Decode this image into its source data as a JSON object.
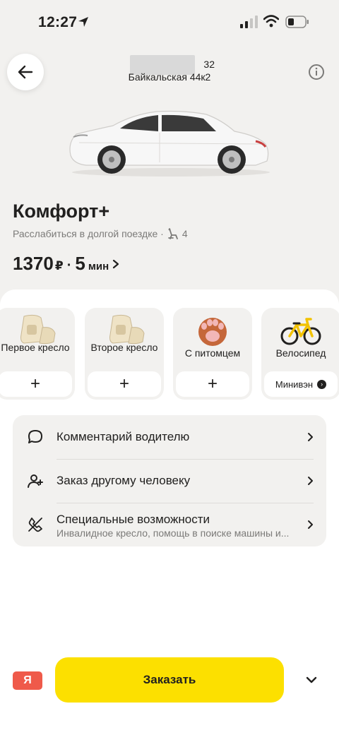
{
  "status_bar": {
    "time": "12:27"
  },
  "header": {
    "route_line1": "32",
    "route_line2": "Байкальская 44к2"
  },
  "tariff": {
    "name": "Комфорт+",
    "description": "Расслабиться в долгой поездке ·",
    "seats": "4",
    "price": "1370",
    "currency": "₽",
    "separator": "·",
    "eta": "5",
    "eta_unit": "мин"
  },
  "options": [
    {
      "label": "Первое кресло",
      "action": "+"
    },
    {
      "label": "Второе кресло",
      "action": "+"
    },
    {
      "label": "С питомцем",
      "action": "+"
    },
    {
      "label": "Велосипед",
      "action": "Минивэн"
    }
  ],
  "list": [
    {
      "title": "Комментарий водителю",
      "icon": "comment-icon"
    },
    {
      "title": "Заказ другому человеку",
      "icon": "add-person-icon"
    },
    {
      "title": "Специальные возможности",
      "subtitle": "Инвалидное кресло, помощь в поиске машины и...",
      "icon": "accessibility-icon"
    }
  ],
  "bottom": {
    "badge": "Я",
    "order_label": "Заказать"
  },
  "colors": {
    "accent_yellow": "#fce000",
    "badge_red": "#ef5a4a",
    "surface": "#f2f1ef"
  }
}
